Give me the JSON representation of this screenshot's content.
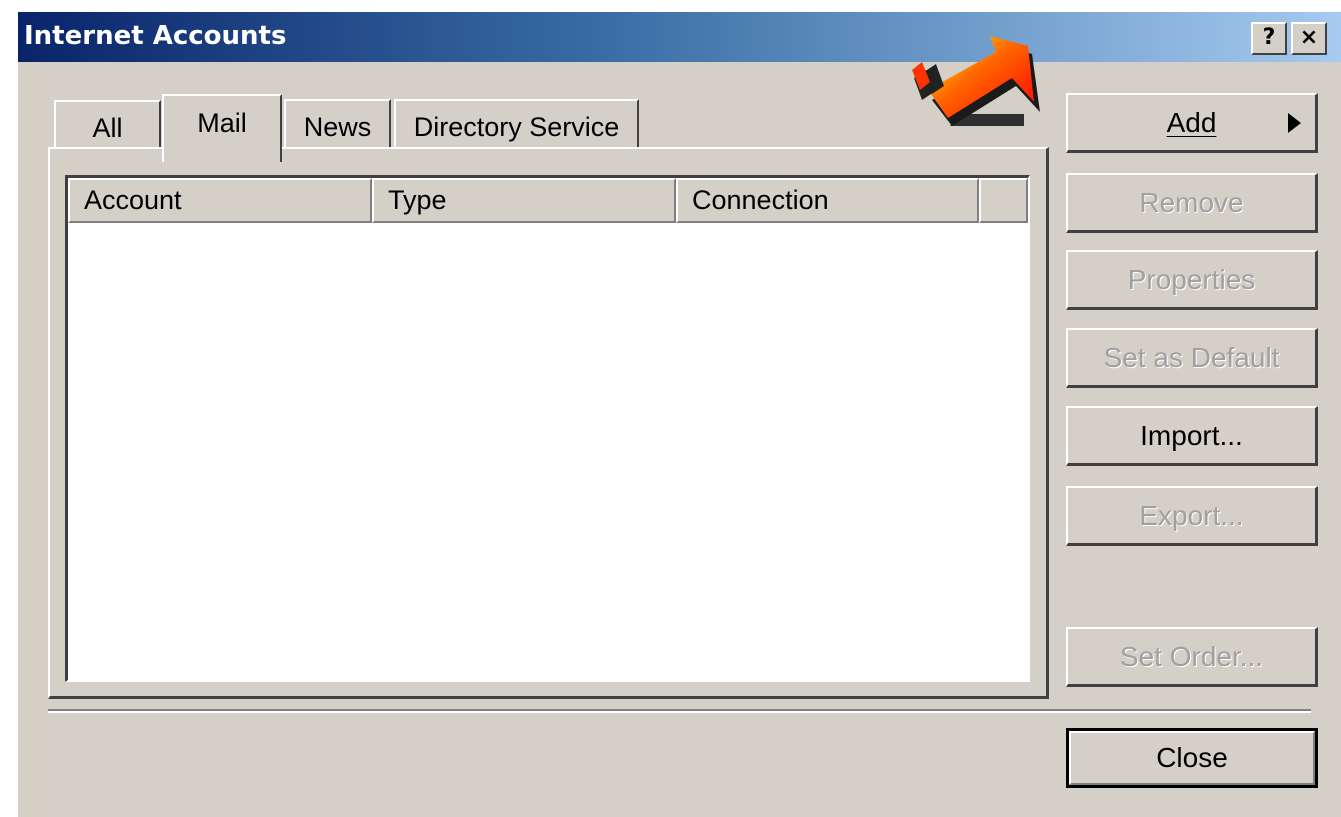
{
  "window": {
    "title": "Internet Accounts",
    "help_label": "?",
    "close_label": "×"
  },
  "tabs": [
    {
      "label": "All",
      "selected": false
    },
    {
      "label": "Mail",
      "selected": true
    },
    {
      "label": "News",
      "selected": false
    },
    {
      "label": "Directory Service",
      "selected": false
    }
  ],
  "accounts_list": {
    "columns": [
      "Account",
      "Type",
      "Connection"
    ],
    "rows": []
  },
  "buttons": {
    "add": {
      "label": "Add",
      "enabled": true
    },
    "remove": {
      "label": "Remove",
      "enabled": false
    },
    "properties": {
      "label": "Properties",
      "enabled": false
    },
    "set_default": {
      "label": "Set as Default",
      "enabled": false
    },
    "import": {
      "label": "Import...",
      "enabled": true
    },
    "export": {
      "label": "Export...",
      "enabled": false
    },
    "set_order": {
      "label": "Set Order...",
      "enabled": false
    },
    "close": {
      "label": "Close",
      "enabled": true
    }
  },
  "icons": {
    "add_submenu": "play-icon",
    "pointer": "arrow-pointer-icon"
  },
  "colors": {
    "titlebar_start": "#0a246a",
    "titlebar_end": "#a6caf0",
    "dialog_face": "#d4d0c8",
    "disabled_text": "#a0a0a0",
    "pointer_arrow": "#ff2a00"
  }
}
